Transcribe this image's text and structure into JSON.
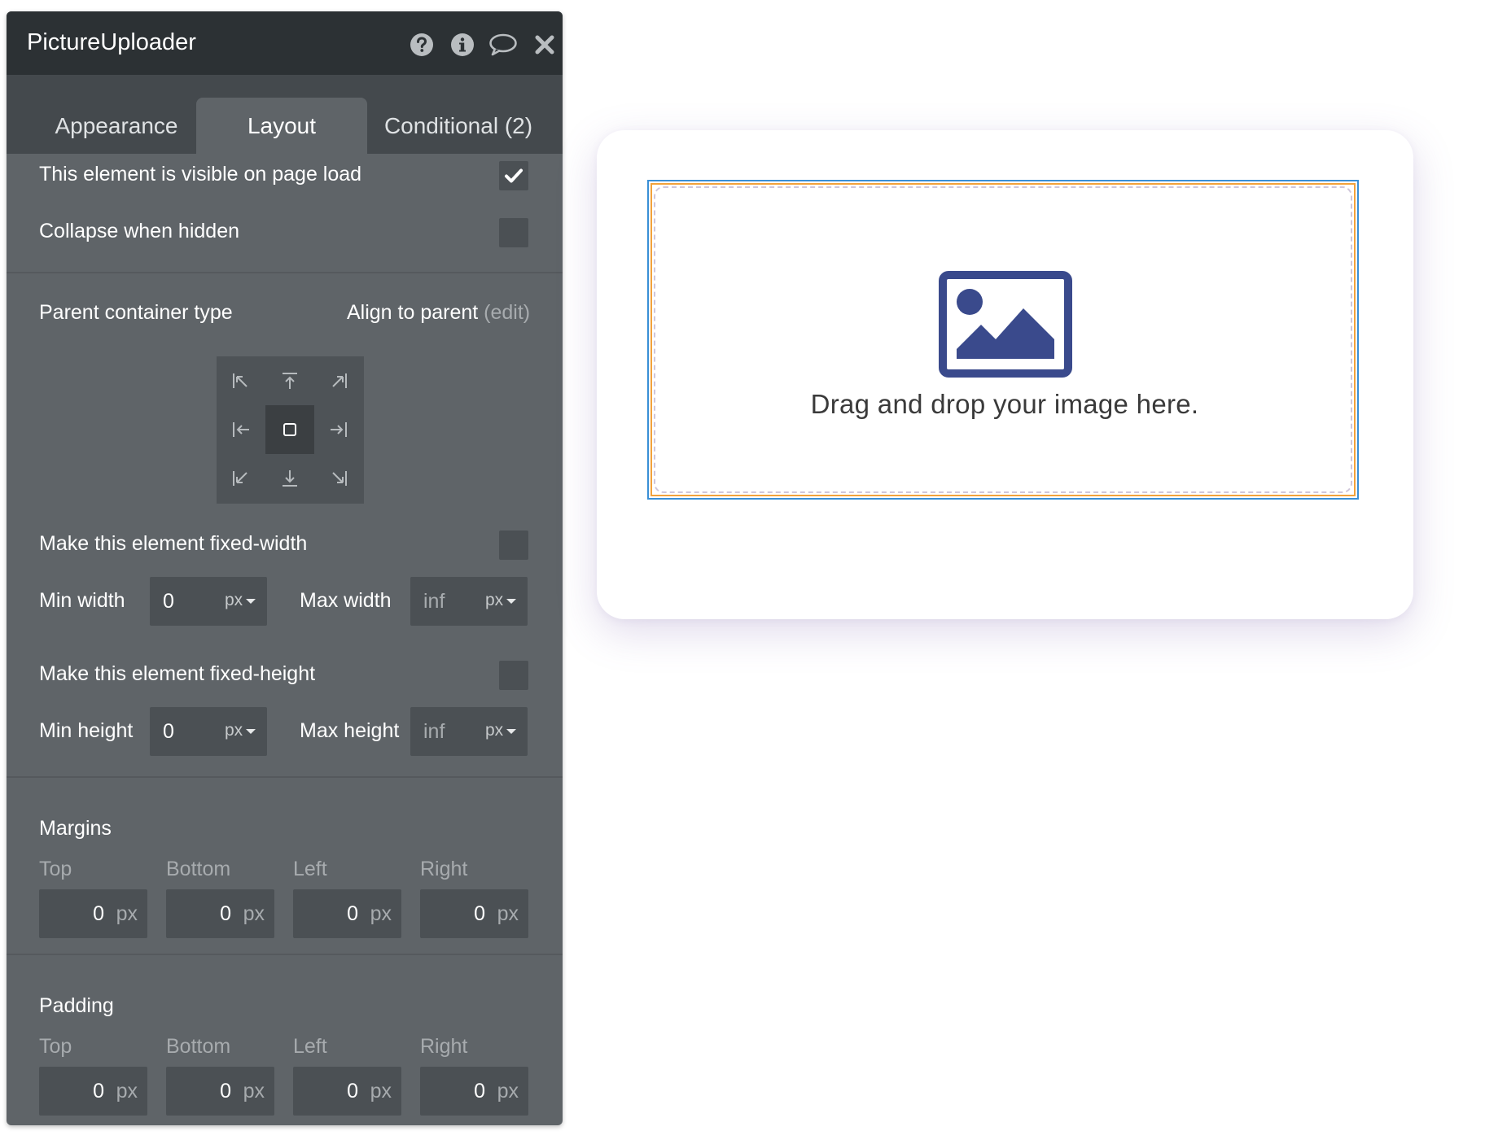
{
  "panel": {
    "title": "PictureUploader",
    "header_icons": [
      "help-icon",
      "info-icon",
      "comment-icon",
      "close-icon"
    ],
    "tabs": [
      {
        "label": "Appearance",
        "active": false
      },
      {
        "label": "Layout",
        "active": true
      },
      {
        "label": "Conditional (2)",
        "active": false
      }
    ],
    "visible_on_load": {
      "label": "This element is visible on page load",
      "checked": true
    },
    "collapse_when_hidden": {
      "label": "Collapse when hidden",
      "checked": false
    },
    "parent_container": {
      "label": "Parent container type",
      "value": "Align to parent",
      "edit": "(edit)",
      "alignment_selected": "center"
    },
    "fixed_width": {
      "label": "Make this element fixed-width",
      "checked": false
    },
    "min_width": {
      "label": "Min width",
      "value": "0",
      "unit": "px"
    },
    "max_width": {
      "label": "Max width",
      "placeholder": "inf",
      "unit": "px"
    },
    "fixed_height": {
      "label": "Make this element fixed-height",
      "checked": false
    },
    "min_height": {
      "label": "Min height",
      "value": "0",
      "unit": "px"
    },
    "max_height": {
      "label": "Max height",
      "placeholder": "inf",
      "unit": "px"
    },
    "margins": {
      "title": "Margins",
      "fields": [
        {
          "label": "Top",
          "value": "0",
          "unit": "px"
        },
        {
          "label": "Bottom",
          "value": "0",
          "unit": "px"
        },
        {
          "label": "Left",
          "value": "0",
          "unit": "px"
        },
        {
          "label": "Right",
          "value": "0",
          "unit": "px"
        }
      ]
    },
    "padding": {
      "title": "Padding",
      "fields": [
        {
          "label": "Top",
          "value": "0",
          "unit": "px"
        },
        {
          "label": "Bottom",
          "value": "0",
          "unit": "px"
        },
        {
          "label": "Left",
          "value": "0",
          "unit": "px"
        },
        {
          "label": "Right",
          "value": "0",
          "unit": "px"
        }
      ]
    }
  },
  "canvas": {
    "uploader_text": "Drag and drop your image here.",
    "uploader_icon": "image-icon",
    "icon_color": "#3a4a8c"
  },
  "colors": {
    "panel_bg": "#5f6468",
    "titlebar_bg": "#2c3134",
    "selection_outline": "#3a8fd6",
    "element_border": "#f2a23b"
  }
}
